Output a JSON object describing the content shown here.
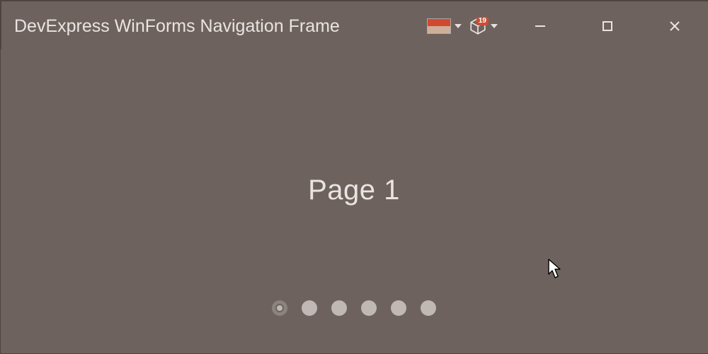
{
  "window": {
    "title": "DevExpress WinForms Navigation Frame"
  },
  "toolbar": {
    "cube_badge": "19"
  },
  "page": {
    "current_label": "Page 1",
    "active_index": 0,
    "dot_count": 6
  }
}
